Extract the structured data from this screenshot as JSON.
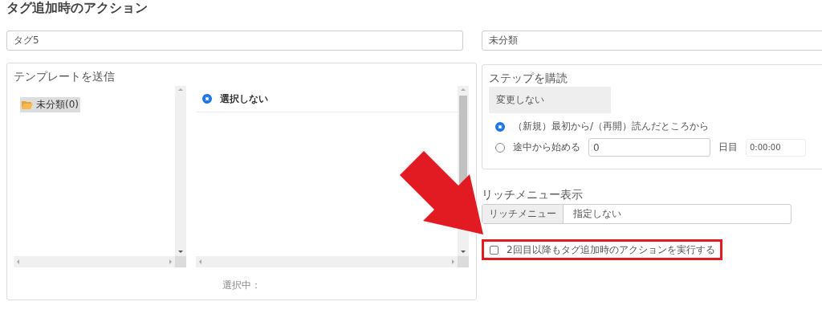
{
  "title": "タグ追加時のアクション",
  "tag_field": {
    "value": "タグ5"
  },
  "category_field": {
    "value": "未分類"
  },
  "send_template": {
    "heading": "テンプレートを送信",
    "folders": [
      {
        "label": "未分類(0)",
        "selected": true
      }
    ],
    "templates": [
      {
        "label": "選択しない",
        "selected": true
      }
    ],
    "selection_label": "選択中："
  },
  "subscribe_step": {
    "heading": "ステップを購読",
    "step_select": "変更しない",
    "options": [
      {
        "label": "（新規）最初から/（再開）読んだところから",
        "selected": true
      },
      {
        "label": "途中から始める",
        "selected": false
      }
    ],
    "day_field": {
      "value": "0"
    },
    "day_unit": "日目",
    "time_field": {
      "value": "0:00:00"
    }
  },
  "rich_menu": {
    "heading": "リッチメニュー表示",
    "addon": "リッチメニュー",
    "value": "指定しない"
  },
  "repeat_action": {
    "label": "2回目以降もタグ追加時のアクションを実行する",
    "checked": false,
    "highlighted": true
  }
}
